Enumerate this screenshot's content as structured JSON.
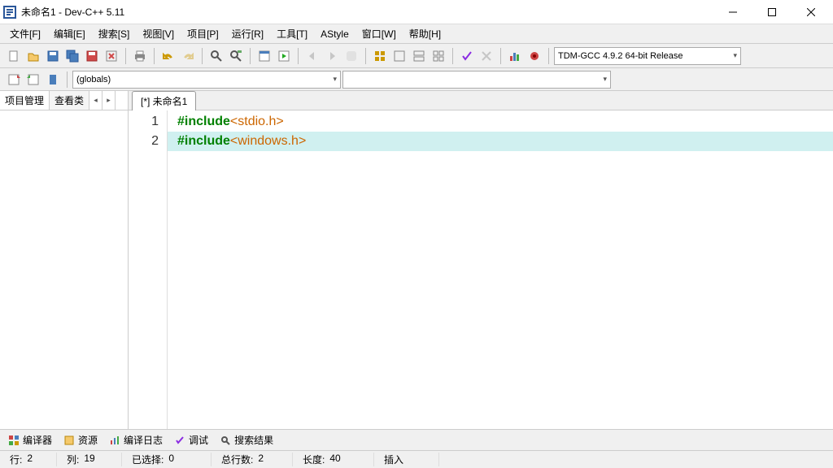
{
  "title": "未命名1 - Dev-C++ 5.11",
  "menu": {
    "file": "文件[F]",
    "edit": "编辑[E]",
    "search": "搜索[S]",
    "view": "视图[V]",
    "project": "项目[P]",
    "run": "运行[R]",
    "tools": "工具[T]",
    "astyle": "AStyle",
    "window": "窗口[W]",
    "help": "帮助[H]"
  },
  "compiler_combo": "TDM-GCC 4.9.2 64-bit Release",
  "scope_combo": "(globals)",
  "class_combo": "",
  "side_tabs": {
    "proj": "项目管理",
    "class": "查看类"
  },
  "file_tab": "[*] 未命名1",
  "code": {
    "lines": [
      {
        "n": "1",
        "include": "#include",
        "hdr": "<stdio.h>"
      },
      {
        "n": "2",
        "include": "#include",
        "hdr": "<windows.h>"
      }
    ],
    "active_line": 1
  },
  "bottom_tabs": {
    "compiler": "编译器",
    "resources": "资源",
    "compile_log": "编译日志",
    "debug": "调试",
    "search_results": "搜索结果"
  },
  "status": {
    "row_label": "行:",
    "row": "2",
    "col_label": "列:",
    "col": "19",
    "sel_label": "已选择:",
    "sel": "0",
    "total_label": "总行数:",
    "total": "2",
    "len_label": "长度:",
    "len": "40",
    "mode": "插入"
  }
}
